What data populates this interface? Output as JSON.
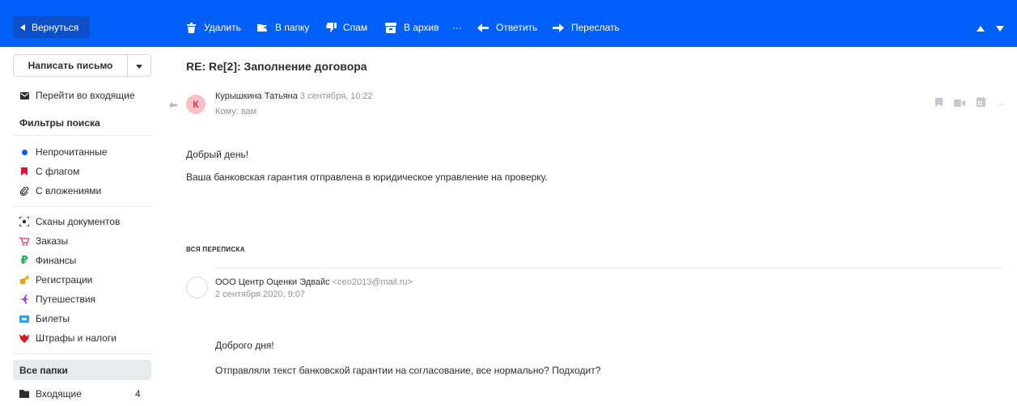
{
  "toolbar": {
    "back": "Вернуться",
    "delete": "Удалить",
    "to_folder": "В папку",
    "spam": "Спам",
    "archive": "В архив",
    "more": "···",
    "reply": "Ответить",
    "forward": "Переслать",
    "colors": {
      "bg": "#005ff9",
      "back_bg": "#0d4fc8"
    }
  },
  "sidebar": {
    "compose": "Написать письмо",
    "goto_inbox": "Перейти во входящие",
    "filters_title": "Фильтры поиска",
    "filters": [
      {
        "label": "Непрочитанные",
        "icon": "dot-icon",
        "color": "#005ff9"
      },
      {
        "label": "С флагом",
        "icon": "flag-icon",
        "color": "#ed0a34"
      },
      {
        "label": "С вложениями",
        "icon": "paperclip-icon",
        "color": "#2c2d2e"
      }
    ],
    "categories": [
      {
        "label": "Сканы документов",
        "icon": "scan-icon"
      },
      {
        "label": "Заказы",
        "icon": "cart-icon"
      },
      {
        "label": "Финансы",
        "icon": "ruble-icon"
      },
      {
        "label": "Регистрации",
        "icon": "key-icon"
      },
      {
        "label": "Путешествия",
        "icon": "plane-icon"
      },
      {
        "label": "Билеты",
        "icon": "ticket-icon"
      },
      {
        "label": "Штрафы и налоги",
        "icon": "crest-icon"
      }
    ],
    "all_folders": "Все папки",
    "inbox": {
      "label": "Входящие",
      "count": "4"
    }
  },
  "message": {
    "subject": "RE: Re[2]: Заполнение договора",
    "avatar_letter": "К",
    "sender_name": "Курышкина Татьяна",
    "date": "3 сентября, 10:22",
    "to": "Кому: вам",
    "greeting": "Добрый день!",
    "text": "Ваша банковская гарантия отправлена в юридическое управление на проверку."
  },
  "thread": {
    "label": "вся переписка",
    "sender_name": "ООО Центр Оценки Эдвайс",
    "sender_email": "<ceo2013@mail.ru>",
    "date": "2 сентября 2020, 9:07",
    "greeting": "Доброго дня!",
    "text": "Отправляли текст банковской гарантии на согласование, все нормально? Подходит?"
  }
}
